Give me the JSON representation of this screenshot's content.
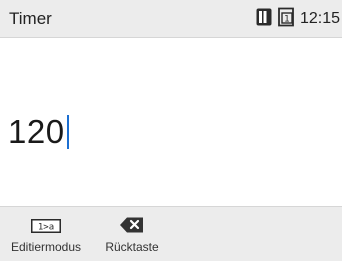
{
  "statusbar": {
    "title": "Timer",
    "clock": "12:15",
    "icons": [
      "battery-icon",
      "sim-card-icon"
    ],
    "sim_number": "1"
  },
  "input": {
    "value": "120"
  },
  "softkeys": {
    "edit_mode": {
      "label": "Editiermodus",
      "icon": "input-mode-icon",
      "icon_text": "1>a"
    },
    "backspace": {
      "label": "Rücktaste",
      "icon": "backspace-icon"
    }
  },
  "colors": {
    "bar_background": "#ececec",
    "caret": "#1c6fd1",
    "text": "#202020"
  }
}
